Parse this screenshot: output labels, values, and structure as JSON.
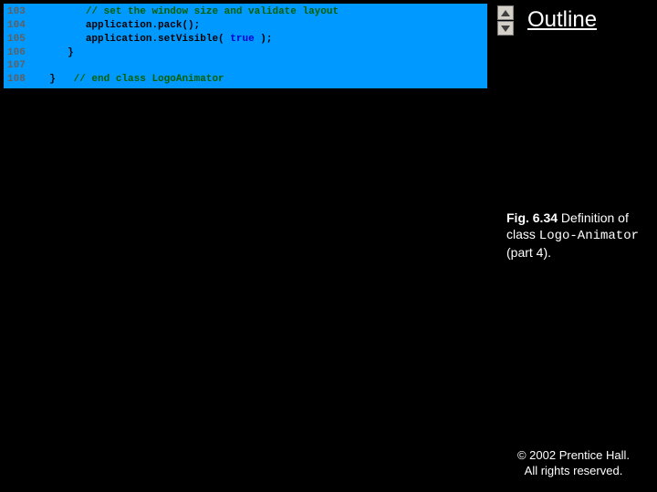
{
  "code": {
    "lines": [
      {
        "num": "103",
        "indent": "         ",
        "seg1": "// set the window size and validate layout",
        "seg1_class": "comment"
      },
      {
        "num": "104",
        "indent": "         ",
        "seg1": "application.pack();",
        "seg1_class": ""
      },
      {
        "num": "105",
        "indent": "         ",
        "seg1": "application.setVisible( ",
        "seg1_class": "",
        "seg2": "true",
        "seg2_class": "keyword",
        "seg3": " );",
        "seg3_class": ""
      },
      {
        "num": "106",
        "indent": "      ",
        "seg1": "}",
        "seg1_class": ""
      },
      {
        "num": "107",
        "indent": "",
        "seg1": "",
        "seg1_class": ""
      },
      {
        "num": "108",
        "indent": "   ",
        "seg1": "}   ",
        "seg1_class": "",
        "seg2": "// end class LogoAnimator",
        "seg2_class": "comment"
      }
    ]
  },
  "outline": {
    "label": "Outline"
  },
  "caption": {
    "fig": "Fig. 6.34",
    "text1": "Definition of class ",
    "classname": "Logo-Animator",
    "text2": " (part 4)."
  },
  "copyright": {
    "line1": "© 2002 Prentice Hall.",
    "line2": "All rights reserved."
  }
}
